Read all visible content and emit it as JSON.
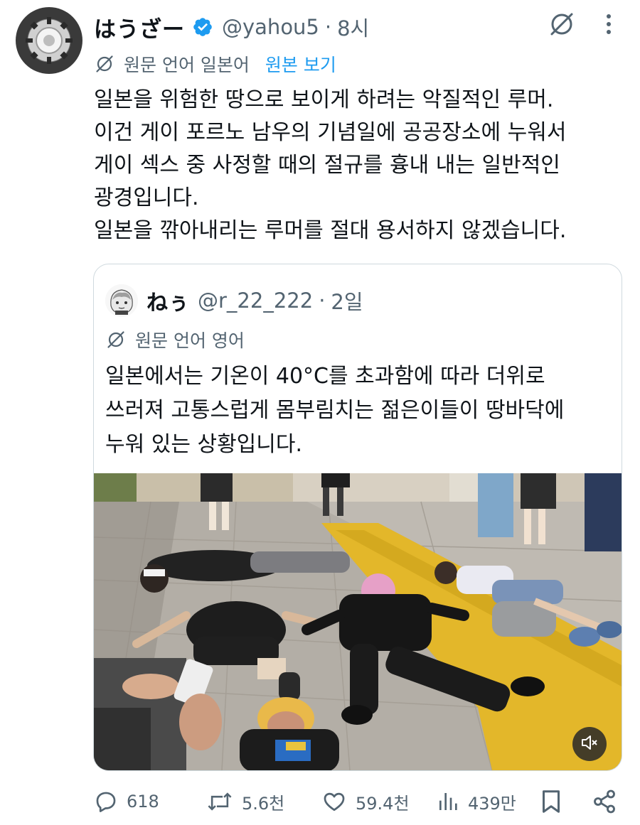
{
  "post": {
    "display_name": "はうざー",
    "handle": "@yahou5",
    "separator": "·",
    "time": "8시",
    "translate_label": "원문 언어 일본어",
    "translate_link": "원본 보기",
    "text": "일본을 위험한 땅으로 보이게 하려는 악질적인 루머.\n이건 게이 포르노 남우의 기념일에 공공장소에 누워서\n게이 섹스 중 사정할 때의 절규를 흉내 내는 일반적인\n광경입니다.\n일본을 깎아내리는 루머를 절대 용서하지 않겠습니다."
  },
  "quote": {
    "display_name": "ねぅ",
    "handle": "@r_22_222",
    "separator": "·",
    "time": "2일",
    "translate_label": "원문 언어 영어",
    "text": "일본에서는 기온이 40°C를 초과함에 따라 더위로\n쓰러져 고통스럽게 몸부림치는 젊은이들이 땅바닥에\n누워 있는 상황입니다."
  },
  "actions": {
    "replies": "618",
    "reposts": "5.6천",
    "likes": "59.4천",
    "views": "439만"
  },
  "icons": [
    "verified-badge-icon",
    "grok-icon",
    "more-icon",
    "translate-icon",
    "mute-icon",
    "reply-icon",
    "repost-icon",
    "like-icon",
    "views-icon",
    "bookmark-icon",
    "share-icon"
  ],
  "colors": {
    "accent": "#1d9bf0",
    "secondary_text": "#536471",
    "text": "#0f1419",
    "border": "#cfd9de"
  }
}
